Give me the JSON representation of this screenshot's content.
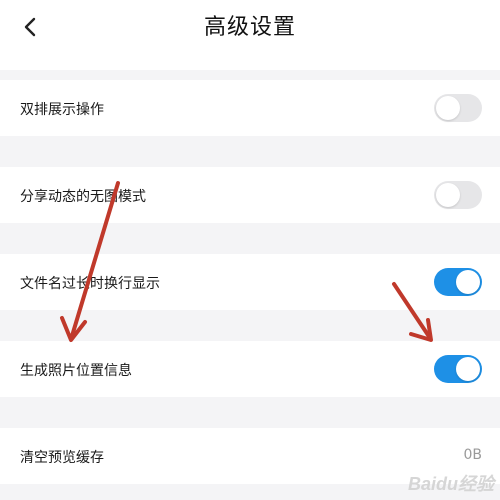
{
  "header": {
    "title": "高级设置"
  },
  "settings": [
    {
      "label": "双排展示操作",
      "control": "toggle",
      "state": "off"
    },
    {
      "label": "分享动态的无图模式",
      "control": "toggle",
      "state": "off"
    },
    {
      "label": "文件名过长时换行显示",
      "control": "toggle",
      "state": "on"
    },
    {
      "label": "生成照片位置信息",
      "control": "toggle",
      "state": "on"
    },
    {
      "label": "清空预览缓存",
      "control": "value",
      "value": "0B"
    }
  ],
  "colors": {
    "toggle_on": "#1e90e6",
    "toggle_off": "#e6e6e8",
    "annotation_arrow": "#c0392b"
  },
  "watermark": "Baidu经验"
}
